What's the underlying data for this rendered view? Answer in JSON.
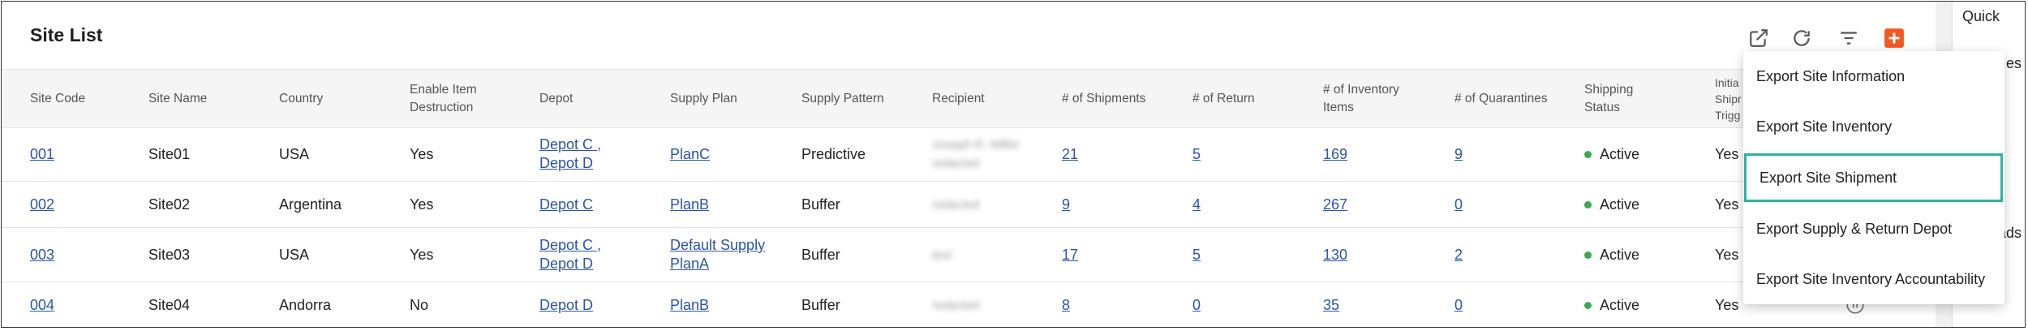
{
  "page": {
    "title": "Site List"
  },
  "toolbar": {
    "icons": [
      "open-external-icon",
      "refresh-icon",
      "filter-icon",
      "add-icon"
    ],
    "accent": "#f15a24"
  },
  "table": {
    "headers": [
      "Site Code",
      "Site Name",
      "Country",
      "Enable Item\nDestruction",
      "Depot",
      "Supply Plan",
      "Supply Pattern",
      "Recipient",
      "# of Shipments",
      "# of Return",
      "# of Inventory\nItems",
      "# of Quarantines",
      "Shipping\nStatus",
      "Initia\nShipr\nTrigg"
    ],
    "rows": [
      {
        "code": "001",
        "name": "Site01",
        "country": "USA",
        "destruction": "Yes",
        "depot": [
          "Depot C ,",
          "Depot D"
        ],
        "plan": [
          "PlanC"
        ],
        "pattern": "Predictive",
        "recipient": [
          "Joseph R. Miller",
          "redacted"
        ],
        "shipments": "21",
        "returns": "5",
        "inventory": "169",
        "quarantines": "9",
        "status": "Active",
        "trigger": "Yes"
      },
      {
        "code": "002",
        "name": "Site02",
        "country": "Argentina",
        "destruction": "Yes",
        "depot": [
          "Depot C"
        ],
        "plan": [
          "PlanB"
        ],
        "pattern": "Buffer",
        "recipient": [
          "redacted"
        ],
        "shipments": "9",
        "returns": "4",
        "inventory": "267",
        "quarantines": "0",
        "status": "Active",
        "trigger": "Yes"
      },
      {
        "code": "003",
        "name": "Site03",
        "country": "USA",
        "destruction": "Yes",
        "depot": [
          "Depot C ,",
          "Depot D"
        ],
        "plan": [
          "Default Supply",
          "PlanA"
        ],
        "pattern": "Buffer",
        "recipient": [
          "test"
        ],
        "shipments": "17",
        "returns": "5",
        "inventory": "130",
        "quarantines": "2",
        "status": "Active",
        "trigger": "Yes"
      },
      {
        "code": "004",
        "name": "Site04",
        "country": "Andorra",
        "destruction": "No",
        "depot": [
          "Depot D"
        ],
        "plan": [
          "PlanB"
        ],
        "pattern": "Buffer",
        "recipient": [
          "redacted"
        ],
        "shipments": "8",
        "returns": "0",
        "inventory": "35",
        "quarantines": "0",
        "status": "Active",
        "trigger": "Yes"
      }
    ],
    "status_color": "#3ba94e",
    "link_color": "#2b54a6"
  },
  "dropdown": {
    "items": [
      "Export Site Information",
      "Export Site Inventory",
      "Export Site Shipment",
      "Export Supply & Return Depot",
      "Export Site Inventory Accountability"
    ],
    "highlighted_index": 2,
    "highlight_color": "#2ab5a0"
  },
  "right_panel": {
    "quick_label": "Quick",
    "partial_1": "es",
    "partial_2": "ads"
  }
}
